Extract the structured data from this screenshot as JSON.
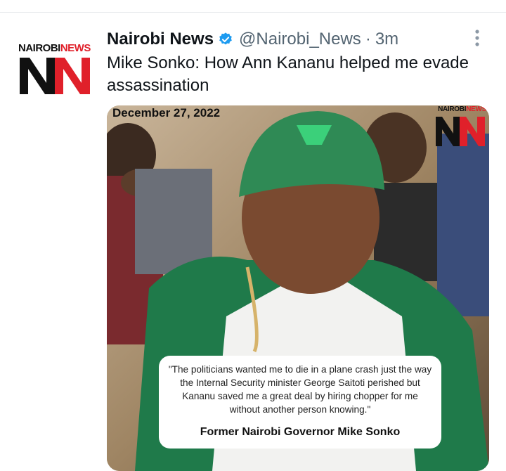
{
  "tweet": {
    "display_name": "Nairobi News",
    "handle": "@Nairobi_News",
    "separator": "·",
    "time": "3m",
    "text": "Mike Sonko: How Ann Kananu helped me evade assassination"
  },
  "avatar": {
    "brand_left": "NAIROBI",
    "brand_right": "NEWS",
    "monogram": "NN"
  },
  "media": {
    "date_overlay": "December 27, 2022",
    "watermark_left": "NAIROBI",
    "watermark_right": "NEWS",
    "quote": "\"The politicians wanted me to die in a plane crash just the way the Internal Security minister George Saitoti perished but Kananu saved me a great deal by hiring chopper for me without another person knowing.\"",
    "attribution": "Former Nairobi Governor Mike Sonko"
  },
  "colors": {
    "brand_red": "#e0202a",
    "verified_blue": "#1d9bf0",
    "text_primary": "#0f1419",
    "text_secondary": "#536471"
  },
  "icons": {
    "verified": "verified-badge-icon",
    "more": "more-vertical-icon"
  }
}
